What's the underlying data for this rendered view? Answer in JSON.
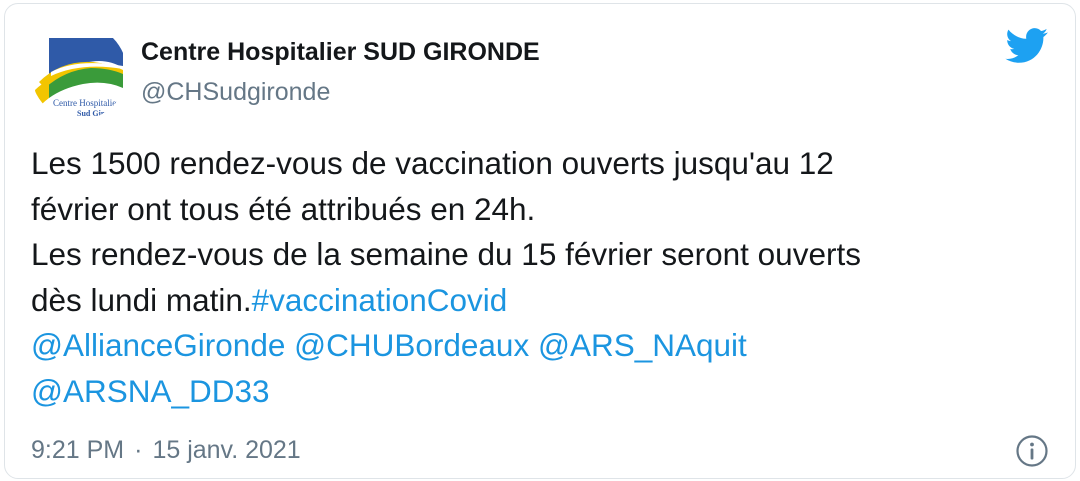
{
  "author": {
    "display_name": "Centre Hospitalier SUD GIRONDE",
    "handle": "@CHSudgironde",
    "avatar_text_line1": "Centre Hospitalier",
    "avatar_text_line2": "Sud Gironde"
  },
  "tweet": {
    "line1": "Les 1500 rendez-vous de vaccination ouverts jusqu'au 12",
    "line2": "février ont tous été attribués en 24h.",
    "line3": "Les rendez-vous de la semaine du 15 février seront ouverts",
    "line4_text": "dès lundi matin.",
    "hashtag": "#vaccinationCovid",
    "mention1": "@AllianceGironde",
    "mention2": "@CHUBordeaux",
    "mention3": "@ARS_NAquit",
    "mention4": "@ARSNA_DD33"
  },
  "meta": {
    "time": "9:21 PM",
    "separator": "·",
    "date": "15 janv. 2021"
  },
  "icons": {
    "brand": "twitter-bird-icon",
    "info": "info-circle-icon"
  },
  "colors": {
    "link": "#1b95e0",
    "twitter_blue": "#1da1f2",
    "text": "#14171a",
    "secondary": "#657786"
  }
}
